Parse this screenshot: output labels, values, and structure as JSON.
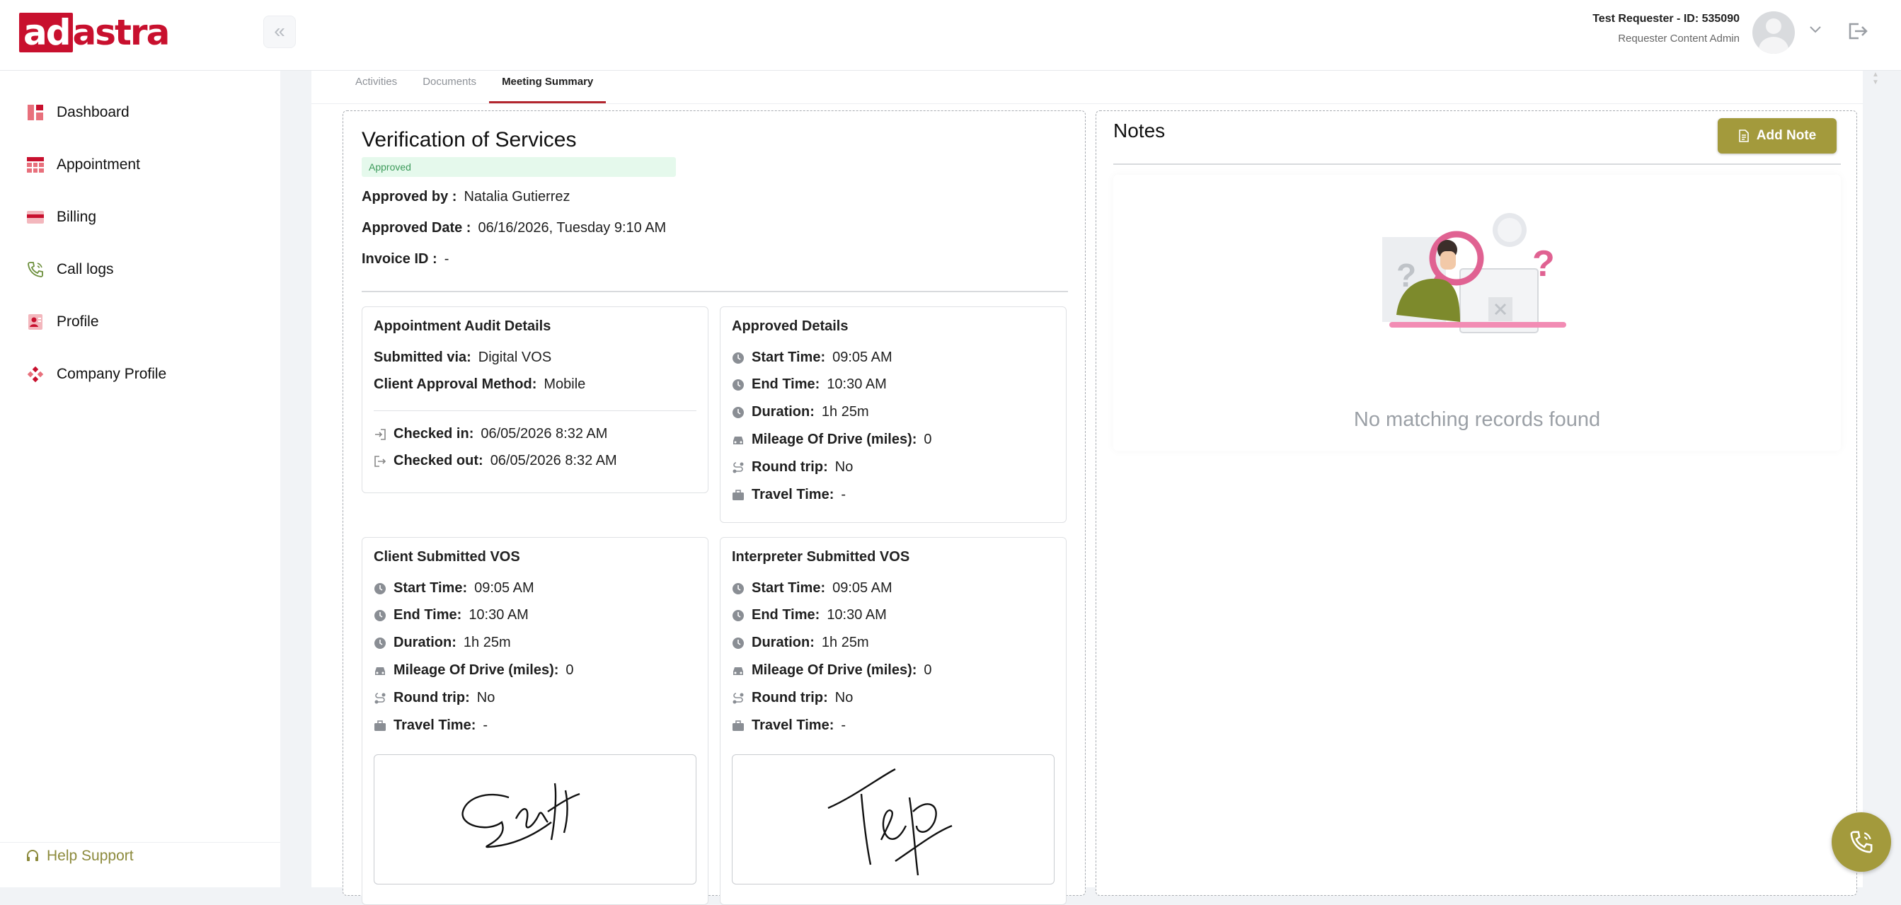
{
  "brand": {
    "logo_part1": "ad",
    "logo_part2": "astra",
    "color": "#c8102e"
  },
  "header": {
    "user_name": "Test Requester - ID: 535090",
    "user_role": "Requester Content Admin",
    "collapse_icon": "double-chevron-left-icon",
    "avatar_icon": "avatar-icon",
    "dropdown_icon": "chevron-down-icon",
    "logout_icon": "logout-icon"
  },
  "sidebar": {
    "items": [
      {
        "label": "Dashboard",
        "icon": "dashboard-icon"
      },
      {
        "label": "Appointment",
        "icon": "calendar-icon"
      },
      {
        "label": "Billing",
        "icon": "billing-icon"
      },
      {
        "label": "Call logs",
        "icon": "phone-icon"
      },
      {
        "label": "Profile",
        "icon": "profile-icon"
      },
      {
        "label": "Company Profile",
        "icon": "company-icon"
      }
    ],
    "help_label": "Help Support"
  },
  "tabs": [
    {
      "label": "Activities",
      "active": false
    },
    {
      "label": "Documents",
      "active": false
    },
    {
      "label": "Meeting Summary",
      "active": true
    }
  ],
  "verification": {
    "title": "Verification of Services",
    "status": "Approved",
    "approved_by_label": "Approved by :",
    "approved_by": "Natalia Gutierrez",
    "approved_date_label": "Approved Date :",
    "approved_date": "06/16/2026, Tuesday 9:10 AM",
    "invoice_label": "Invoice ID :",
    "invoice_id": "-"
  },
  "audit": {
    "title": "Appointment Audit Details",
    "submitted_via_label": "Submitted via:",
    "submitted_via": "Digital VOS",
    "approval_method_label": "Client Approval Method:",
    "approval_method": "Mobile",
    "checked_in_label": "Checked in:",
    "checked_in": "06/05/2026 8:32 AM",
    "checked_out_label": "Checked out:",
    "checked_out": "06/05/2026 8:32 AM"
  },
  "approved_details": {
    "title": "Approved Details",
    "start_label": "Start Time:",
    "start": "09:05 AM",
    "end_label": "End Time:",
    "end": "10:30 AM",
    "duration_label": "Duration:",
    "duration": "1h 25m",
    "mileage_label": "Mileage Of Drive (miles):",
    "mileage": "0",
    "round_label": "Round trip:",
    "round": "No",
    "travel_label": "Travel Time:",
    "travel": "-"
  },
  "client_vos": {
    "title": "Client Submitted VOS",
    "start_label": "Start Time:",
    "start": "09:05 AM",
    "end_label": "End Time:",
    "end": "10:30 AM",
    "duration_label": "Duration:",
    "duration": "1h 25m",
    "mileage_label": "Mileage Of Drive (miles):",
    "mileage": "0",
    "round_label": "Round trip:",
    "round": "No",
    "travel_label": "Travel Time:",
    "travel": "-"
  },
  "interpreter_vos": {
    "title": "Interpreter Submitted VOS",
    "start_label": "Start Time:",
    "start": "09:05 AM",
    "end_label": "End Time:",
    "end": "10:30 AM",
    "duration_label": "Duration:",
    "duration": "1h 25m",
    "mileage_label": "Mileage Of Drive (miles):",
    "mileage": "0",
    "round_label": "Round trip:",
    "round": "No",
    "travel_label": "Travel Time:",
    "travel": "-"
  },
  "notes": {
    "title": "Notes",
    "add_label": "Add Note",
    "empty_text": "No matching records found"
  },
  "colors": {
    "accent": "#a39a3c",
    "brand_red": "#c8102e",
    "approved_bg": "#e5f9ec",
    "approved_text": "#3c9a5a"
  }
}
